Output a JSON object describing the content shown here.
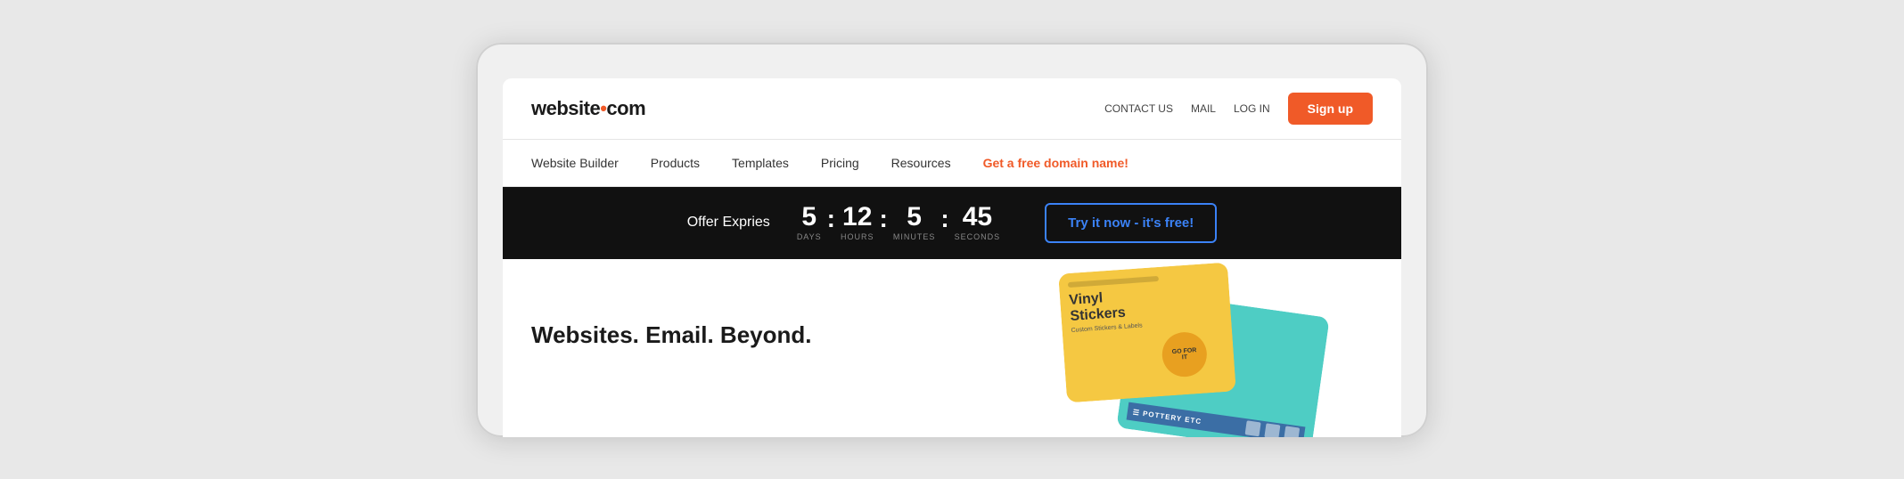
{
  "logo": {
    "text_before_dot": "website",
    "dot": "•",
    "text_after_dot": "com"
  },
  "top_nav": {
    "contact_us": "CONTACT US",
    "mail": "MAIL",
    "log_in": "LOG IN",
    "sign_up": "Sign up"
  },
  "main_nav": {
    "items": [
      {
        "label": "Website Builder",
        "promo": false
      },
      {
        "label": "Products",
        "promo": false
      },
      {
        "label": "Templates",
        "promo": false
      },
      {
        "label": "Pricing",
        "promo": false
      },
      {
        "label": "Resources",
        "promo": false
      },
      {
        "label": "Get a free domain name!",
        "promo": true
      }
    ]
  },
  "banner": {
    "offer_text": "Offer Expries",
    "days": "5",
    "days_label": "DAYS",
    "hours": "12",
    "hours_label": "HOURS",
    "minutes": "5",
    "minutes_label": "MINUTES",
    "seconds": "45",
    "seconds_label": "SECONDS",
    "cta": "Try it now - it's free!"
  },
  "hero": {
    "headline": "Websites. Email. Beyond."
  },
  "colors": {
    "orange": "#f05a28",
    "blue": "#3b82f6",
    "black": "#111111"
  }
}
